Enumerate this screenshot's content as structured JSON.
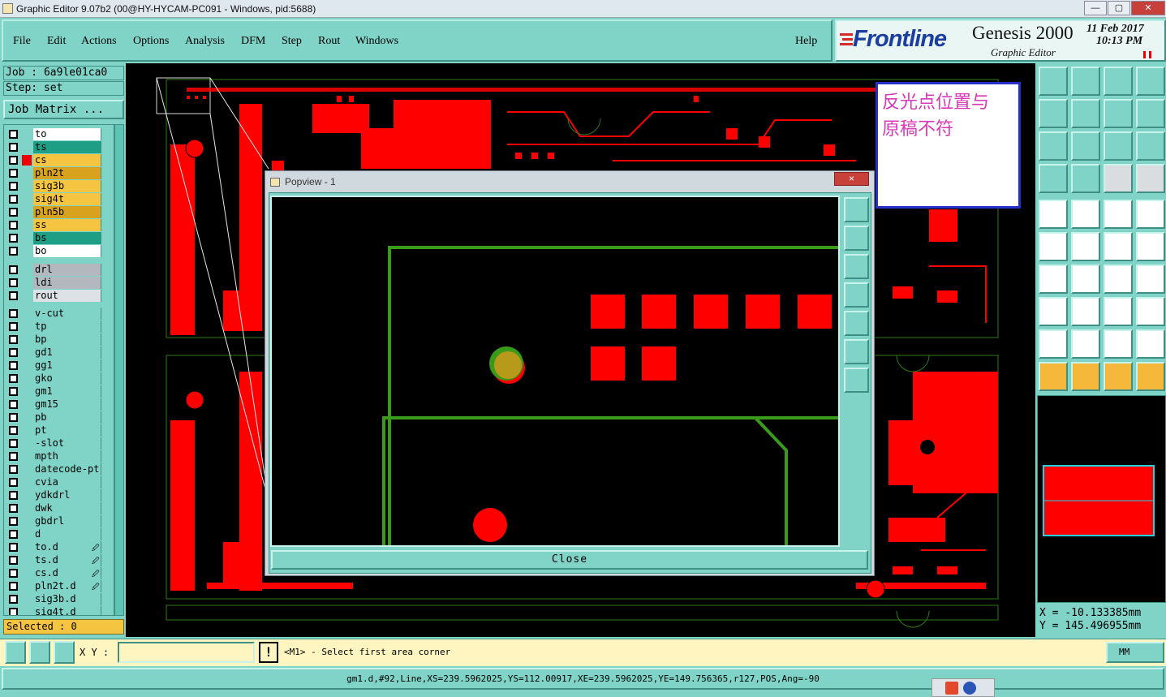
{
  "window": {
    "title": "Graphic Editor 9.07b2 (00@HY-HYCAM-PC091 - Windows, pid:5688)"
  },
  "menu": [
    "File",
    "Edit",
    "Actions",
    "Options",
    "Analysis",
    "DFM",
    "Step",
    "Rout",
    "Windows"
  ],
  "help": "Help",
  "logo": {
    "brand": "Frontline",
    "product": "Genesis 2000",
    "editor": "Graphic Editor",
    "date": "11 Feb 2017",
    "time": "10:13 PM"
  },
  "job": {
    "job_label": "Job : 6a9le01ca0",
    "step_label": "Step: set",
    "matrix_button": "Job Matrix ..."
  },
  "layers": [
    {
      "name": "to",
      "color": "#ffffff",
      "marker": ""
    },
    {
      "name": "ts",
      "color": "#1f9e86",
      "marker": ""
    },
    {
      "name": "cs",
      "color": "#f5c542",
      "marker": "red"
    },
    {
      "name": "pln2t",
      "color": "#d9a21e",
      "marker": ""
    },
    {
      "name": "sig3b",
      "color": "#f5c542",
      "marker": ""
    },
    {
      "name": "sig4t",
      "color": "#f5c542",
      "marker": ""
    },
    {
      "name": "pln5b",
      "color": "#d9a21e",
      "marker": ""
    },
    {
      "name": "ss",
      "color": "#f5c542",
      "marker": ""
    },
    {
      "name": "bs",
      "color": "#1f9e86",
      "marker": ""
    },
    {
      "name": "bo",
      "color": "#ffffff",
      "marker": ""
    },
    {
      "name": "drl",
      "color": "#b2b8be",
      "marker": ""
    },
    {
      "name": "ldi",
      "color": "#b2b8be",
      "marker": ""
    },
    {
      "name": "rout",
      "color": "#dde2e6",
      "marker": ""
    },
    {
      "name": "v-cut",
      "color": "#7fd3c7",
      "marker": ""
    },
    {
      "name": "tp",
      "color": "#7fd3c7",
      "marker": ""
    },
    {
      "name": "bp",
      "color": "#7fd3c7",
      "marker": ""
    },
    {
      "name": "gd1",
      "color": "#7fd3c7",
      "marker": ""
    },
    {
      "name": "gg1",
      "color": "#7fd3c7",
      "marker": ""
    },
    {
      "name": "gko",
      "color": "#7fd3c7",
      "marker": ""
    },
    {
      "name": "gm1",
      "color": "#7fd3c7",
      "marker": ""
    },
    {
      "name": "gm15",
      "color": "#7fd3c7",
      "marker": ""
    },
    {
      "name": "pb",
      "color": "#7fd3c7",
      "marker": ""
    },
    {
      "name": "pt",
      "color": "#7fd3c7",
      "marker": ""
    },
    {
      "name": "-slot",
      "color": "#7fd3c7",
      "marker": ""
    },
    {
      "name": "mpth",
      "color": "#7fd3c7",
      "marker": ""
    },
    {
      "name": "datecode-pt",
      "color": "#7fd3c7",
      "marker": ""
    },
    {
      "name": "cvia",
      "color": "#7fd3c7",
      "marker": ""
    },
    {
      "name": "ydkdrl",
      "color": "#7fd3c7",
      "marker": ""
    },
    {
      "name": "dwk",
      "color": "#7fd3c7",
      "marker": ""
    },
    {
      "name": "gbdrl",
      "color": "#7fd3c7",
      "marker": ""
    },
    {
      "name": "d",
      "color": "#7fd3c7",
      "marker": ""
    },
    {
      "name": "to.d",
      "color": "#7fd3c7",
      "marker": "link"
    },
    {
      "name": "ts.d",
      "color": "#7fd3c7",
      "marker": "link"
    },
    {
      "name": "cs.d",
      "color": "#7fd3c7",
      "marker": "link"
    },
    {
      "name": "pln2t.d",
      "color": "#7fd3c7",
      "marker": "link"
    },
    {
      "name": "sig3b.d",
      "color": "#7fd3c7",
      "marker": ""
    },
    {
      "name": "sig4t.d",
      "color": "#7fd3c7",
      "marker": ""
    }
  ],
  "selected": "Selected : 0",
  "note": {
    "line1": "反光点位置与",
    "line2": "原稿不符"
  },
  "popview": {
    "title": "Popview - 1",
    "close_x": "×",
    "close_button": "Close"
  },
  "coords": {
    "x": "X  = -10.133385mm",
    "y": "Y  = 145.496955mm"
  },
  "bottom": {
    "xy_label": "X Y :",
    "xy_value": "",
    "warn": "!",
    "prompt": "<M1> - Select first area corner",
    "units": "MM"
  },
  "status": "gm1.d,#92,Line,XS=239.5962025,YS=112.00917,XE=239.5962025,YE=149.756365,r127,POS,Ang=-90",
  "colors": {
    "panel": "#7fd3c7",
    "copper": "#ff0000",
    "outline": "#3a9a1a",
    "note_border": "#2430c8",
    "note_text": "#d63ab8"
  }
}
